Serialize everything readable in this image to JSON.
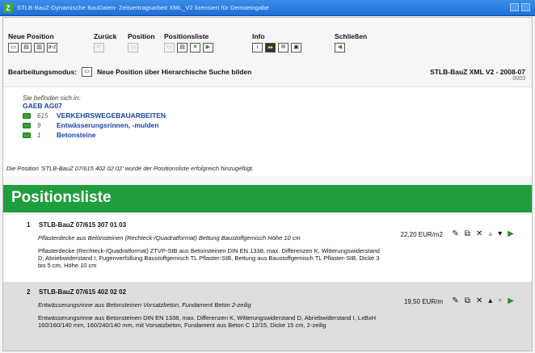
{
  "window": {
    "title": "STLB-BauZ-Dynamische BauDaten- Zeitvertragsarbeit XML_V2 lizensiert für Demoeingabe"
  },
  "toolbar": {
    "groups": [
      {
        "label": "Neue Position"
      },
      {
        "label": "Zurück"
      },
      {
        "label": "Position"
      },
      {
        "label": "Positionsliste"
      },
      {
        "label": "Info"
      },
      {
        "label": "Schließen"
      }
    ]
  },
  "mode": {
    "label": "Bearbeitungsmodus:",
    "text": "Neue Position über Hierarchische Suche bilden",
    "version": "STLB-BauZ XML V2 - 2008-07",
    "version_sub": "0003"
  },
  "location": {
    "intro": "Sie befinden sich in:",
    "root": "GAEB AG07",
    "items": [
      {
        "num": "615",
        "name": "VERKEHRSWEGEBAUARBEITEN"
      },
      {
        "num": "9",
        "name": "Entwässerungsrinnen, -mulden"
      },
      {
        "num": "1",
        "name": "Betonsteine"
      }
    ],
    "message": "Die Position 'STLB-BauZ 07/615 402 02 02' wurde der Positionsliste erfolgreich hinzugefügt."
  },
  "banner": {
    "title": "Positionsliste"
  },
  "positions": [
    {
      "num": "1",
      "code": "STLB-BauZ 07/615 307 01 03",
      "short": "Pflasterdecke aus Betonsteinen (Rechteck-/Quadratformat) Bettung Baustoffgemisch Höhe 10 cm",
      "long": "Pflasterdecke (Rechteck-/Quadratformat) ZTVP-StB aus Betonsteinen DIN EN 1338, max. Differenzen K, Witterungswiderstand D, Abriebwiderstand I, Fugenverfüllung Baustoffgemisch TL Pflaster-StB, Bettung aus Baustoffgemisch TL Pflaster-StB, Dicke 3 bis 5 cm, Höhe 10 cm",
      "price": "22,20 EUR/m2"
    },
    {
      "num": "2",
      "code": "STLB-BauZ 07/615 402 02 02",
      "short": "Entwässerungsrinne aus Betonsteinen Vorsatzbeton, Fundament Beton 2-zeilig",
      "long": "Entwässerungsrinne aus Betonsteinen DIN EN 1338, max. Differenzen K, Witterungswiderstand D, Abriebwiderstand I, LxBxH 160/160/140 mm, 160/240/140 mm, mit Vorsatzbeton, Fundament aus Beton C 12/15, Dicke 15 cm, 2-zeilig",
      "price": "19,50 EUR/m"
    }
  ],
  "colors": {
    "banner": "#1e9e3c",
    "link": "#1a43a8",
    "titlebar": "#1f6fd9"
  }
}
